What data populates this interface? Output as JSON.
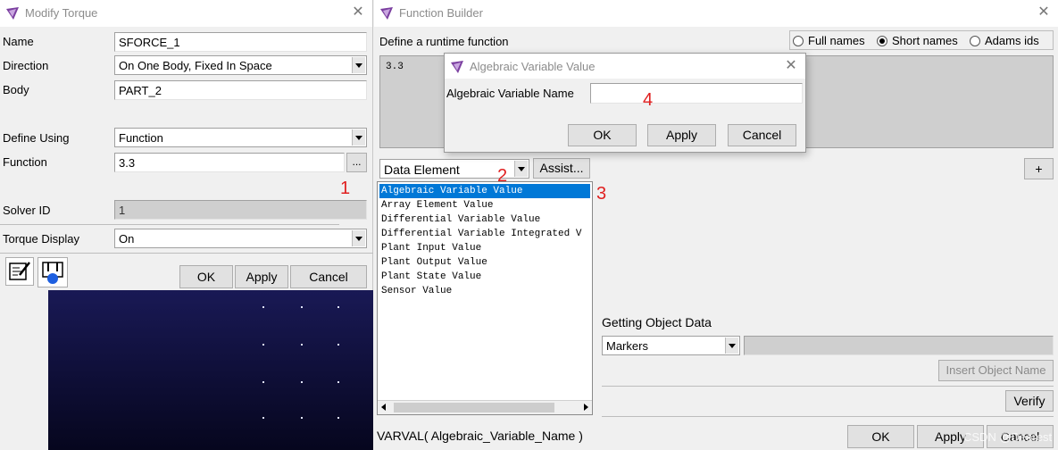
{
  "modify_torque": {
    "title": "Modify Torque",
    "name_label": "Name",
    "name_value": "SFORCE_1",
    "direction_label": "Direction",
    "direction_value": "On One Body, Fixed In Space",
    "body_label": "Body",
    "body_value": "PART_2",
    "define_using_label": "Define Using",
    "define_using_value": "Function",
    "function_label": "Function",
    "function_value": "3.3",
    "function_browse": "...",
    "solver_id_label": "Solver ID",
    "solver_id_value": "1",
    "torque_display_label": "Torque Display",
    "torque_display_value": "On",
    "ok": "OK",
    "apply": "Apply",
    "cancel": "Cancel"
  },
  "function_builder": {
    "title": "Function Builder",
    "define_label": "Define a runtime function",
    "name_options": [
      "Full names",
      "Short names",
      "Adams ids"
    ],
    "selected_name_option": "Short names",
    "expression": "3.3",
    "category": "Data Element",
    "assist": "Assist...",
    "plus_button": "+",
    "functions": [
      "Algebraic Variable Value",
      "Array Element Value",
      "Differential Variable Value",
      "Differential Variable Integrated V",
      "Plant Input Value",
      "Plant Output Value",
      "Plant State Value",
      "Sensor Value"
    ],
    "selected_function": "Algebraic Variable Value",
    "syntax": "VARVAL( Algebraic_Variable_Name )",
    "getting_object_data_label": "Getting Object Data",
    "object_type": "Markers",
    "insert_object_name": "Insert Object Name",
    "verify": "Verify",
    "ok": "OK",
    "apply": "Apply",
    "cancel": "Cancel",
    "watermark": "CSDN @Dearest"
  },
  "alg_var_dialog": {
    "title": "Algebraic Variable Value",
    "name_label": "Algebraic Variable Name",
    "name_value": "",
    "ok": "OK",
    "apply": "Apply",
    "cancel": "Cancel"
  },
  "annotations": [
    "1",
    "2",
    "3",
    "4"
  ],
  "colors": {
    "selection": "#0078d7",
    "annotation": "#e02020",
    "viewport": "#14144a",
    "adams_icon": "#7b3fa0"
  }
}
